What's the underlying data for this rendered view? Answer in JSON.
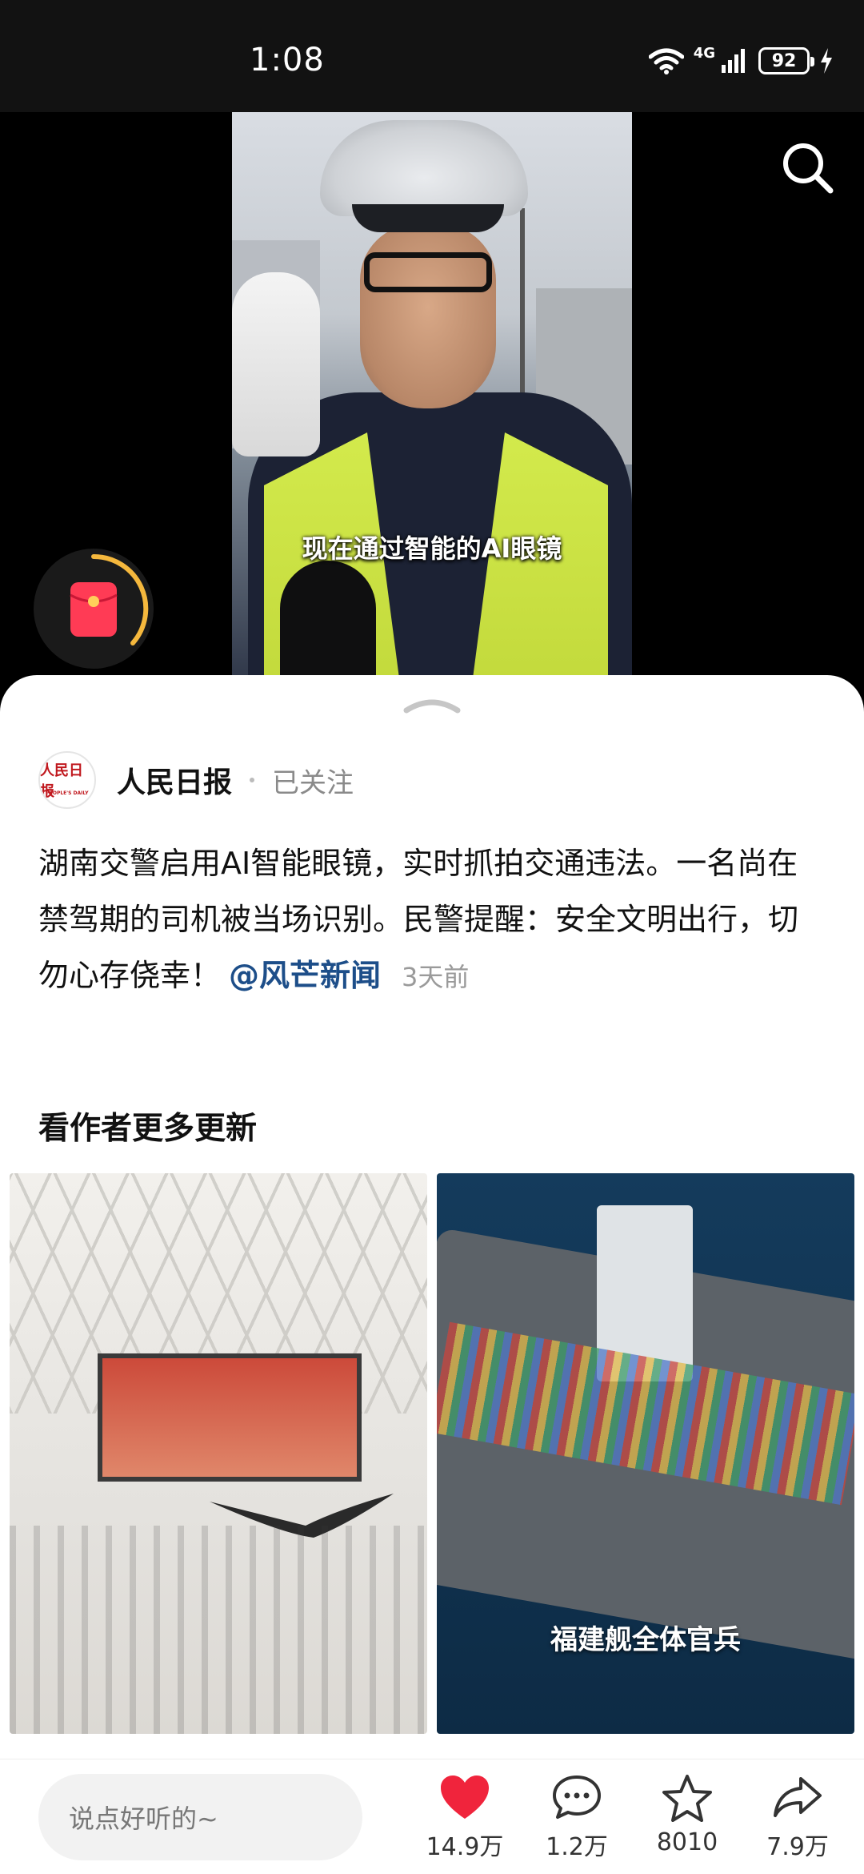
{
  "status_bar": {
    "time": "1:08",
    "network": "4G",
    "battery": "92"
  },
  "video": {
    "caption": "现在通过智能的AI眼镜"
  },
  "author": {
    "avatar_text": "人民日报",
    "avatar_sub": "PEOPLE'S DAILY",
    "name": "人民日报",
    "follow_state": "已关注"
  },
  "post": {
    "text": "湖南交警启用AI智能眼镜，实时抓拍交通违法。一名尚在禁驾期的司机被当场识别。民警提醒：安全文明出行，切勿心存侥幸！",
    "mention": "@风芒新闻",
    "time": "3天前"
  },
  "more_section": {
    "title": "看作者更多更新",
    "items": [
      {
        "caption": ""
      },
      {
        "caption": "福建舰全体官兵"
      }
    ]
  },
  "bottom_bar": {
    "comment_placeholder": "说点好听的~",
    "like_count": "14.9万",
    "comment_count": "1.2万",
    "favorite_count": "8010",
    "share_count": "7.9万"
  },
  "colors": {
    "like": "#f0243c",
    "mention": "#1d4e89",
    "status_bar_bg": "#121212",
    "redpacket": "#ff3b55"
  }
}
